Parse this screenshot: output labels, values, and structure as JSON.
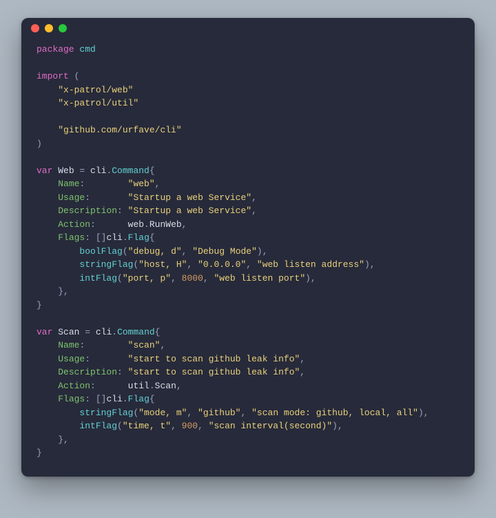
{
  "colors": {
    "background_page": "#aeb8c2",
    "background_window": "#272a3a",
    "keyword": "#e06cc6",
    "identifier": "#d8dee9",
    "function": "#62d0d3",
    "field": "#7ec36e",
    "string": "#e8d07c",
    "number": "#d49b63",
    "punctuation": "#9aa2bf"
  },
  "window_controls": [
    "close",
    "minimize",
    "maximize"
  ],
  "code": {
    "package_keyword": "package",
    "package_name": "cmd",
    "import_keyword": "import",
    "imports": [
      "\"x-patrol/web\"",
      "\"x-patrol/util\"",
      "\"github.com/urfave/cli\""
    ],
    "var_keyword": "var",
    "web_var": "Web",
    "scan_var": "Scan",
    "assign": " = ",
    "cli_prefix": "cli",
    "command_type": "Command",
    "flag_type": "Flag",
    "lbrace": "{",
    "rbrace": "}",
    "rbrace_comma": "},",
    "lparen": " (",
    "rparen": ")",
    "flags_bracket": ": []",
    "web_fields": {
      "name_key": "Name",
      "name_val": "\"web\"",
      "usage_key": "Usage",
      "usage_val": "\"Startup a web Service\"",
      "desc_key": "Description",
      "desc_val": "\"Startup a web Service\"",
      "action_key": "Action",
      "action_pkg": "web",
      "action_fn": "RunWeb",
      "flags_key": "Flags"
    },
    "web_flags": {
      "bool_fn": "boolFlag",
      "bool_arg1": "\"debug, d\"",
      "bool_arg2": "\"Debug Mode\"",
      "string_fn": "stringFlag",
      "string_arg1": "\"host, H\"",
      "string_arg2": "\"0.0.0.0\"",
      "string_arg3": "\"web listen address\"",
      "int_fn": "intFlag",
      "int_arg1": "\"port, p\"",
      "int_num": "8000",
      "int_arg3": "\"web listen port\""
    },
    "scan_fields": {
      "name_key": "Name",
      "name_val": "\"scan\"",
      "usage_key": "Usage",
      "usage_val": "\"start to scan github leak info\"",
      "desc_key": "Description",
      "desc_val": "\"start to scan github leak info\"",
      "action_key": "Action",
      "action_pkg": "util",
      "action_fn": "Scan",
      "flags_key": "Flags"
    },
    "scan_flags": {
      "string_fn": "stringFlag",
      "string_arg1": "\"mode, m\"",
      "string_arg2": "\"github\"",
      "string_arg3": "\"scan mode: github, local, all\"",
      "int_fn": "intFlag",
      "int_arg1": "\"time, t\"",
      "int_num": "900",
      "int_arg3": "\"scan interval(second)\""
    }
  }
}
